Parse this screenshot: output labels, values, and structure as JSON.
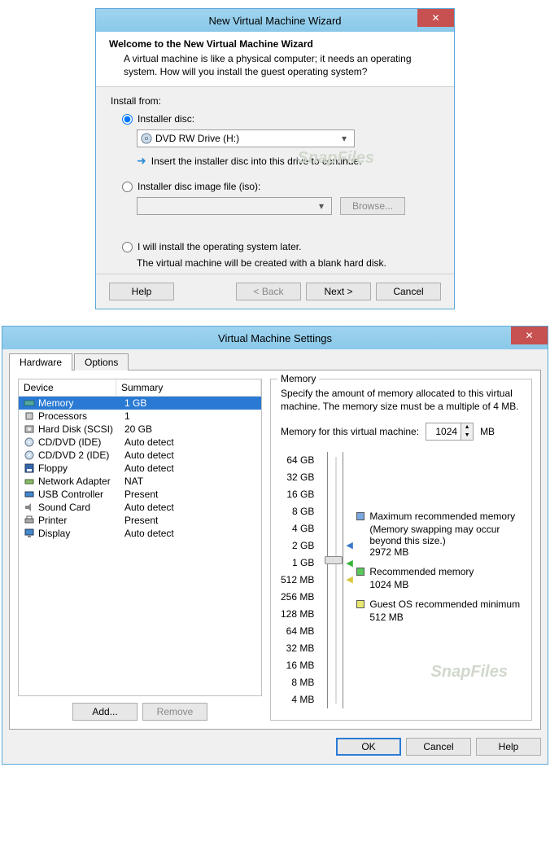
{
  "wizard": {
    "title": "New Virtual Machine Wizard",
    "header_title": "Welcome to the New Virtual Machine Wizard",
    "header_desc": "A virtual machine is like a physical computer; it needs an operating system. How will you install the guest operating system?",
    "install_from": "Install from:",
    "opt_disc": "Installer disc:",
    "disc_drive": "DVD RW Drive (H:)",
    "disc_hint": "Insert the installer disc into this drive to continue.",
    "opt_iso": "Installer disc image file (iso):",
    "browse": "Browse...",
    "opt_later": "I will install the operating system later.",
    "later_desc": "The virtual machine will be created with a blank hard disk.",
    "help": "Help",
    "back": "< Back",
    "next": "Next >",
    "cancel": "Cancel"
  },
  "settings": {
    "title": "Virtual Machine Settings",
    "tabs": {
      "hardware": "Hardware",
      "options": "Options"
    },
    "cols": {
      "device": "Device",
      "summary": "Summary"
    },
    "devices": [
      {
        "name": "Memory",
        "summary": "1 GB",
        "icon": "memory"
      },
      {
        "name": "Processors",
        "summary": "1",
        "icon": "cpu"
      },
      {
        "name": "Hard Disk (SCSI)",
        "summary": "20 GB",
        "icon": "hdd"
      },
      {
        "name": "CD/DVD (IDE)",
        "summary": "Auto detect",
        "icon": "cd"
      },
      {
        "name": "CD/DVD 2 (IDE)",
        "summary": "Auto detect",
        "icon": "cd"
      },
      {
        "name": "Floppy",
        "summary": "Auto detect",
        "icon": "floppy"
      },
      {
        "name": "Network Adapter",
        "summary": "NAT",
        "icon": "net"
      },
      {
        "name": "USB Controller",
        "summary": "Present",
        "icon": "usb"
      },
      {
        "name": "Sound Card",
        "summary": "Auto detect",
        "icon": "sound"
      },
      {
        "name": "Printer",
        "summary": "Present",
        "icon": "printer"
      },
      {
        "name": "Display",
        "summary": "Auto detect",
        "icon": "display"
      }
    ],
    "add": "Add...",
    "remove": "Remove",
    "memory": {
      "group": "Memory",
      "desc": "Specify the amount of memory allocated to this virtual machine. The memory size must be a multiple of 4 MB.",
      "label": "Memory for this virtual machine:",
      "value": "1024",
      "unit": "MB",
      "scale": [
        "64 GB",
        "32 GB",
        "16 GB",
        "8 GB",
        "4 GB",
        "2 GB",
        "1 GB",
        "512 MB",
        "256 MB",
        "128 MB",
        "64 MB",
        "32 MB",
        "16 MB",
        "8 MB",
        "4 MB"
      ],
      "max_label": "Maximum recommended memory",
      "max_note": "(Memory swapping may occur beyond this size.)",
      "max_val": "2972 MB",
      "rec_label": "Recommended memory",
      "rec_val": "1024 MB",
      "min_label": "Guest OS recommended minimum",
      "min_val": "512 MB"
    },
    "ok": "OK",
    "cancel": "Cancel",
    "help": "Help"
  },
  "watermark": "SnapFiles"
}
